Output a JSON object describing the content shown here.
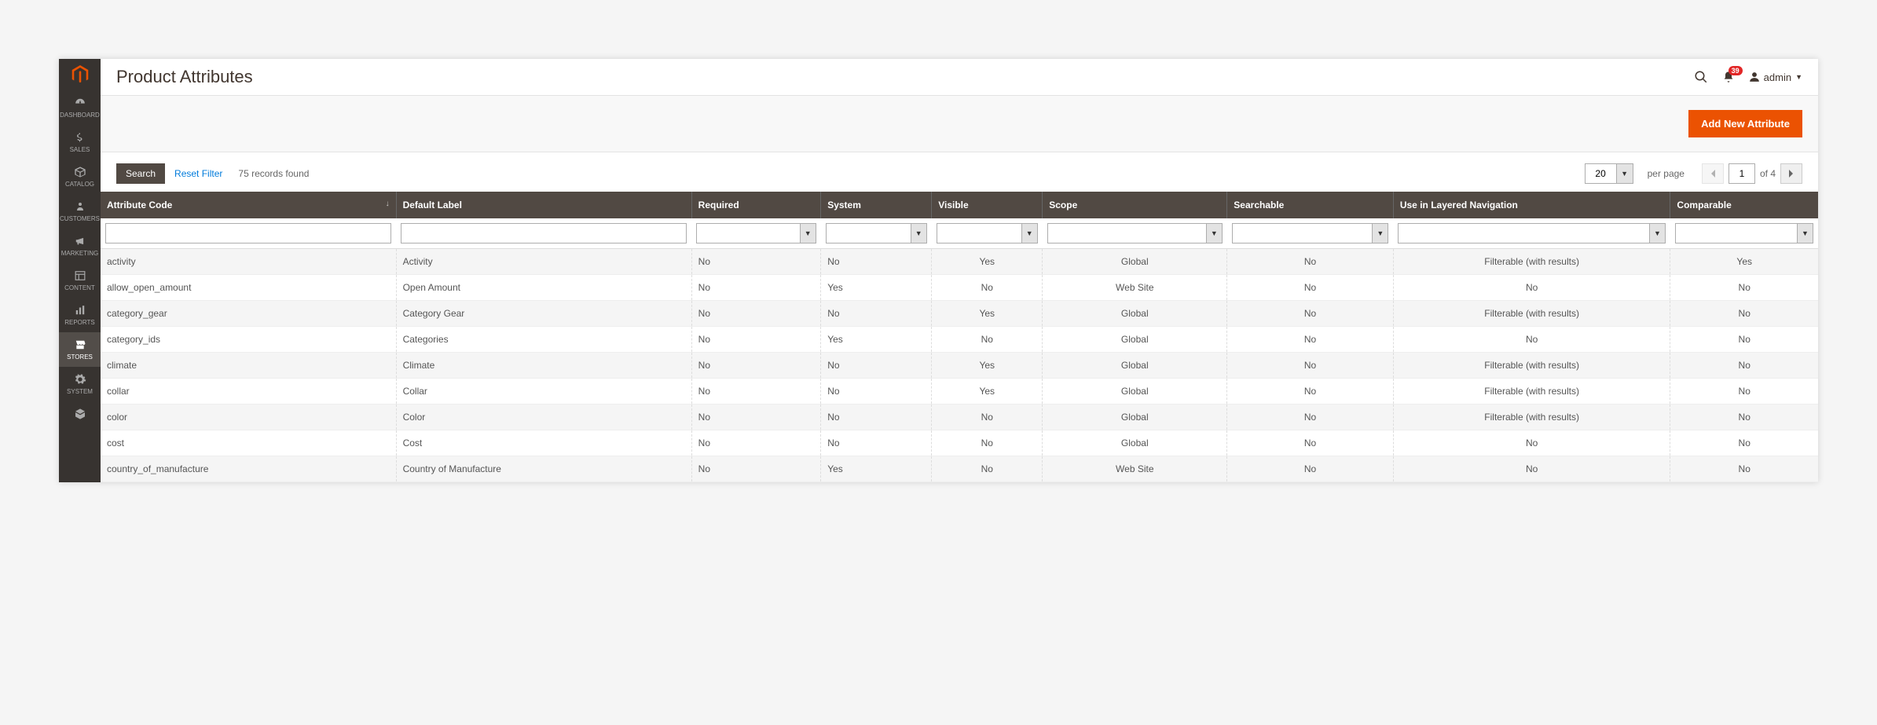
{
  "sidebar": {
    "items": [
      {
        "id": "dashboard",
        "label": "DASHBOARD",
        "icon": "dashboard"
      },
      {
        "id": "sales",
        "label": "SALES",
        "icon": "dollar"
      },
      {
        "id": "catalog",
        "label": "CATALOG",
        "icon": "box"
      },
      {
        "id": "customers",
        "label": "CUSTOMERS",
        "icon": "person"
      },
      {
        "id": "marketing",
        "label": "MARKETING",
        "icon": "megaphone"
      },
      {
        "id": "content",
        "label": "CONTENT",
        "icon": "layout"
      },
      {
        "id": "reports",
        "label": "REPORTS",
        "icon": "barchart"
      },
      {
        "id": "stores",
        "label": "STORES",
        "icon": "storefront",
        "active": true
      },
      {
        "id": "system",
        "label": "SYSTEM",
        "icon": "gear"
      },
      {
        "id": "partners",
        "label": "",
        "icon": "cube"
      }
    ]
  },
  "header": {
    "title": "Product Attributes",
    "notification_count": "39",
    "user_label": "admin"
  },
  "actions": {
    "add_label": "Add New Attribute"
  },
  "controls": {
    "search_label": "Search",
    "reset_label": "Reset Filter",
    "records_found": "75 records found",
    "per_page_value": "20",
    "per_page_label": "per page",
    "current_page": "1",
    "total_pages_text": "of 4"
  },
  "columns": [
    "Attribute Code",
    "Default Label",
    "Required",
    "System",
    "Visible",
    "Scope",
    "Searchable",
    "Use in Layered Navigation",
    "Comparable"
  ],
  "rows": [
    {
      "code": "activity",
      "label": "Activity",
      "required": "No",
      "system": "No",
      "visible": "Yes",
      "scope": "Global",
      "searchable": "No",
      "layered": "Filterable (with results)",
      "comparable": "Yes"
    },
    {
      "code": "allow_open_amount",
      "label": "Open Amount",
      "required": "No",
      "system": "Yes",
      "visible": "No",
      "scope": "Web Site",
      "searchable": "No",
      "layered": "No",
      "comparable": "No"
    },
    {
      "code": "category_gear",
      "label": "Category Gear",
      "required": "No",
      "system": "No",
      "visible": "Yes",
      "scope": "Global",
      "searchable": "No",
      "layered": "Filterable (with results)",
      "comparable": "No"
    },
    {
      "code": "category_ids",
      "label": "Categories",
      "required": "No",
      "system": "Yes",
      "visible": "No",
      "scope": "Global",
      "searchable": "No",
      "layered": "No",
      "comparable": "No"
    },
    {
      "code": "climate",
      "label": "Climate",
      "required": "No",
      "system": "No",
      "visible": "Yes",
      "scope": "Global",
      "searchable": "No",
      "layered": "Filterable (with results)",
      "comparable": "No"
    },
    {
      "code": "collar",
      "label": "Collar",
      "required": "No",
      "system": "No",
      "visible": "Yes",
      "scope": "Global",
      "searchable": "No",
      "layered": "Filterable (with results)",
      "comparable": "No"
    },
    {
      "code": "color",
      "label": "Color",
      "required": "No",
      "system": "No",
      "visible": "No",
      "scope": "Global",
      "searchable": "No",
      "layered": "Filterable (with results)",
      "comparable": "No"
    },
    {
      "code": "cost",
      "label": "Cost",
      "required": "No",
      "system": "No",
      "visible": "No",
      "scope": "Global",
      "searchable": "No",
      "layered": "No",
      "comparable": "No"
    },
    {
      "code": "country_of_manufacture",
      "label": "Country of Manufacture",
      "required": "No",
      "system": "Yes",
      "visible": "No",
      "scope": "Web Site",
      "searchable": "No",
      "layered": "No",
      "comparable": "No"
    }
  ]
}
